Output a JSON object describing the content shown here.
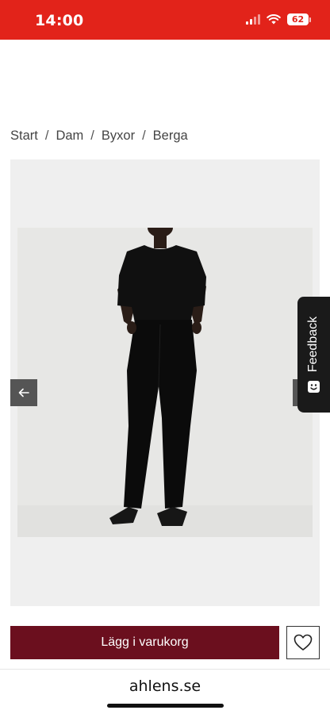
{
  "status_bar": {
    "time": "14:00",
    "battery": "62"
  },
  "breadcrumb": {
    "items": [
      "Start",
      "Dam",
      "Byxor",
      "Berga"
    ],
    "separator": "/"
  },
  "gallery": {
    "image_alt": "Model in black t-shirt and black trousers",
    "prev_icon": "arrow-left-icon",
    "next_icon": "arrow-right-icon"
  },
  "feedback": {
    "label": "Feedback"
  },
  "cart": {
    "add_label": "Lägg i varukorg"
  },
  "browser": {
    "url": "ahlens.se"
  },
  "colors": {
    "status_bar": "#e2231a",
    "add_to_cart": "#6b0f1e",
    "gallery_bg": "#efefef",
    "feedback_bg": "#1a1a1a"
  }
}
